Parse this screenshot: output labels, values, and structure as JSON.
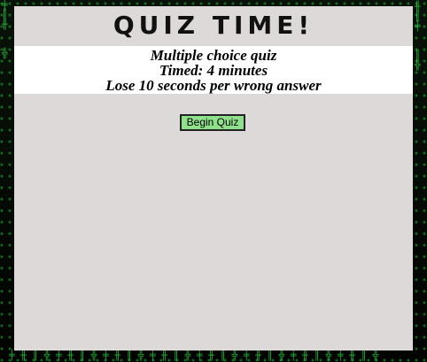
{
  "header": {
    "title": "QUIZ TIME!"
  },
  "intro": {
    "line1": "Multiple choice quiz",
    "line2": "Timed: 4 minutes",
    "line3": "Lose 10 seconds per wrong answer"
  },
  "actions": {
    "begin_label": "Begin Quiz"
  },
  "colors": {
    "panel": "#ded9d9",
    "info_band": "#ffffff",
    "button": "#8fe08a",
    "background": "#050805",
    "matrix_green": "#2fd84a"
  }
}
